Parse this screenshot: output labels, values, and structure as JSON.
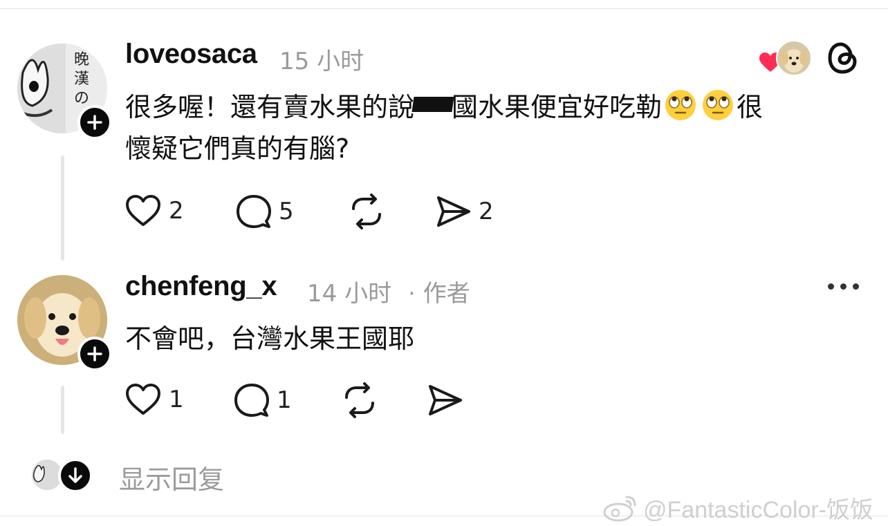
{
  "comments": [
    {
      "username": "loveosaca",
      "time": "15 小时",
      "text_line1_a": "很多喔！還有賣水果的說",
      "text_line1_b": "國水果便宜好吃勒",
      "text_line1_c": "很",
      "text_line2": "懷疑它們真的有腦?",
      "emojis": [
        "face-with-rolling-eyes",
        "face-with-rolling-eyes"
      ],
      "likes": "2",
      "replies": "5",
      "shares": "2"
    },
    {
      "username": "chenfeng_x",
      "time": "14 小时",
      "role": "· 作者",
      "text": "不會吧，台灣水果王國耶",
      "likes": "1",
      "replies": "1"
    }
  ],
  "show_replies": "显示回复",
  "watermark": "@FantasticColor-饭饭",
  "colors": {
    "like_red": "#ff2d55",
    "muted": "#9a9a9a",
    "text": "#111111"
  }
}
